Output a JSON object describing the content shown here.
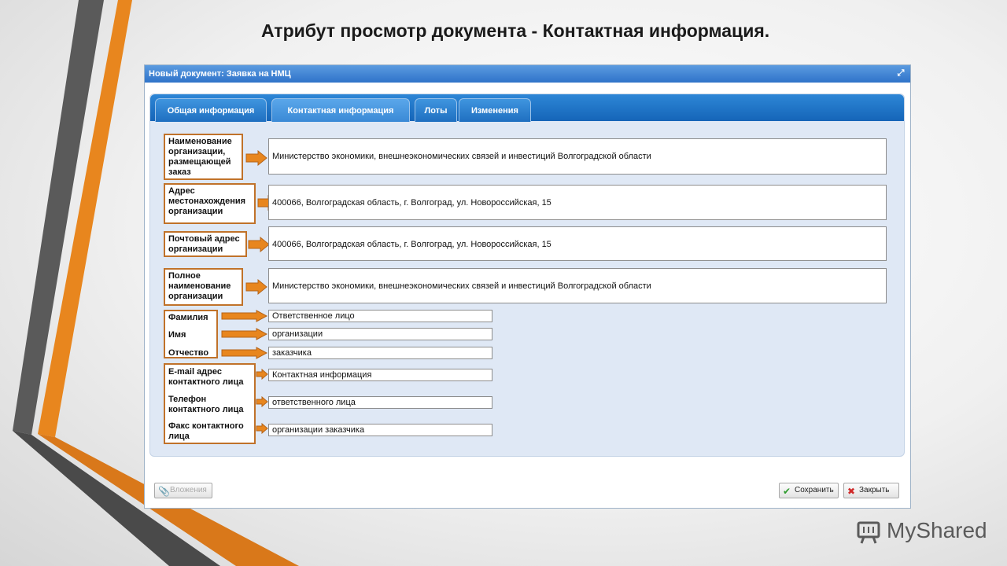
{
  "slide": {
    "title": "Атрибут просмотр документа - Контактная информация."
  },
  "window": {
    "title": "Новый документ: Заявка на НМЦ",
    "maximize_icon": "maximize-icon"
  },
  "tabs": [
    {
      "label": "Общая информация",
      "active": false
    },
    {
      "label": "Контактная информация",
      "active": true
    },
    {
      "label": "Лоты",
      "active": false
    },
    {
      "label": "Изменения",
      "active": false
    }
  ],
  "fields": {
    "org_placing_order": {
      "label": "Наименование организации, размещающей заказ",
      "value": "Министерство экономики, внешнеэкономических связей и инвестиций Волгоградской области"
    },
    "org_location_address": {
      "label": "Адрес местонахождения организации",
      "value": "400066, Волгоградская область, г. Волгоград, ул. Новороссийская, 15"
    },
    "org_postal_address": {
      "label": "Почтовый адрес организации",
      "value": "400066, Волгоградская область, г. Волгоград, ул. Новороссийская, 15"
    },
    "org_full_name": {
      "label": "Полное наименование организации",
      "value": "Министерство экономики, внешнеэкономических связей и инвестиций Волгоградской области"
    },
    "last_name": {
      "label": "Фамилия",
      "value": "Ответственное лицо"
    },
    "first_name": {
      "label": "Имя",
      "value": "организации"
    },
    "patronymic": {
      "label": "Отчество",
      "value": "заказчика"
    },
    "contact_email": {
      "label": "E-mail адрес контактного лица",
      "value": "Контактная информация"
    },
    "contact_phone": {
      "label": "Телефон контактного лица",
      "value": "ответственного лица"
    },
    "contact_fax": {
      "label": "Факс контактного лица",
      "value": "организации заказчика"
    }
  },
  "buttons": {
    "attachments": {
      "label": "Вложения",
      "icon": "paperclip-icon",
      "enabled": false
    },
    "save": {
      "label": "Сохранить",
      "icon": "checkmark-icon"
    },
    "close": {
      "label": "Закрыть",
      "icon": "x-icon"
    }
  },
  "watermark": {
    "text": "MyShared"
  },
  "colors": {
    "accent_orange": "#e8861e",
    "label_border": "#c0722a",
    "tab_blue": "#1a6fc2",
    "titlebar_blue": "#3a80d2"
  }
}
